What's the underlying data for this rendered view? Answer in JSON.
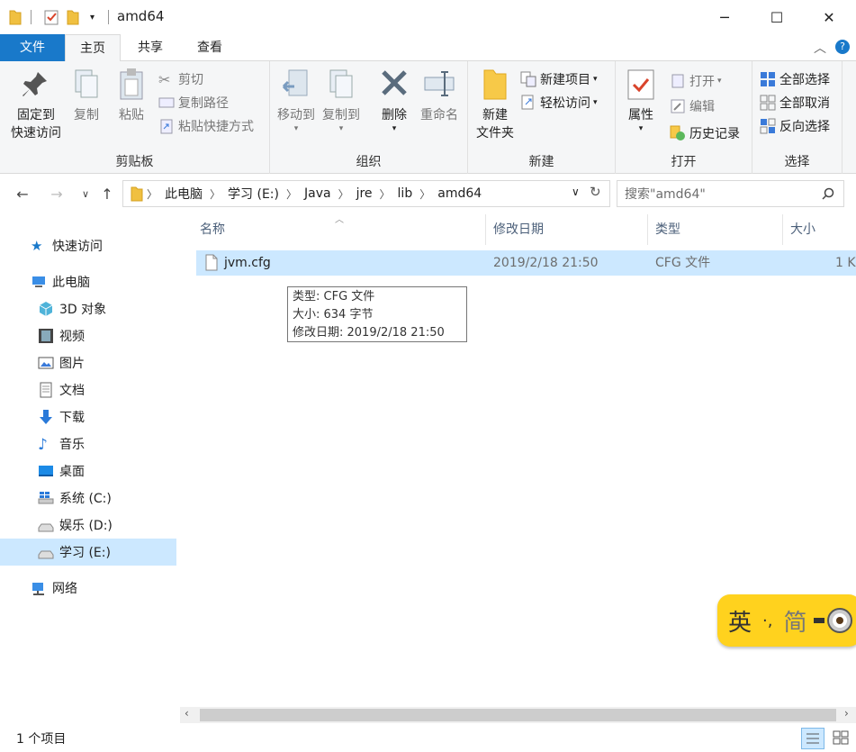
{
  "window": {
    "title": "amd64",
    "minimize_label": "─",
    "maximize_label": "☐",
    "close_label": "✕"
  },
  "ribbon_tabs": {
    "file": "文件",
    "home": "主页",
    "share": "共享",
    "view": "查看"
  },
  "ribbon": {
    "clipboard": {
      "label": "剪贴板",
      "pin": "固定到\n快速访问",
      "pin_line1": "固定到",
      "pin_line2": "快速访问",
      "copy": "复制",
      "paste": "粘贴",
      "cut": "剪切",
      "copy_path": "复制路径",
      "paste_shortcut": "粘贴快捷方式"
    },
    "organize": {
      "label": "组织",
      "move_to": "移动到",
      "copy_to": "复制到",
      "delete": "删除",
      "rename": "重命名"
    },
    "new": {
      "label": "新建",
      "new_folder_line1": "新建",
      "new_folder_line2": "文件夹",
      "new_item": "新建项目",
      "easy_access": "轻松访问"
    },
    "open": {
      "label": "打开",
      "properties": "属性",
      "open": "打开",
      "edit": "编辑",
      "history": "历史记录"
    },
    "select": {
      "label": "选择",
      "select_all": "全部选择",
      "select_none": "全部取消",
      "invert": "反向选择"
    }
  },
  "address": {
    "crumbs": [
      "此电脑",
      "学习 (E:)",
      "Java",
      "jre",
      "lib",
      "amd64"
    ],
    "search_placeholder": "搜索\"amd64\""
  },
  "nav": {
    "quick_access": "快速访问",
    "this_pc": "此电脑",
    "objects3d": "3D 对象",
    "videos": "视频",
    "pictures": "图片",
    "documents": "文档",
    "downloads": "下载",
    "music": "音乐",
    "desktop": "桌面",
    "drive_c": "系统 (C:)",
    "drive_d": "娱乐 (D:)",
    "drive_e": "学习 (E:)",
    "network": "网络"
  },
  "columns": {
    "name": "名称",
    "modified": "修改日期",
    "type": "类型",
    "size": "大小"
  },
  "files": [
    {
      "name": "jvm.cfg",
      "modified": "2019/2/18 21:50",
      "type": "CFG 文件",
      "size": "1 K"
    }
  ],
  "tooltip": {
    "type": "类型: CFG 文件",
    "size": "大小: 634 字节",
    "modified": "修改日期: 2019/2/18 21:50"
  },
  "status": {
    "count": "1 个项目"
  },
  "ime": {
    "lang": "英",
    "punct": "·,",
    "mode": "简"
  },
  "colors": {
    "accent": "#1979ca",
    "selection": "#cce8ff",
    "ime_bg": "#ffd21e"
  }
}
